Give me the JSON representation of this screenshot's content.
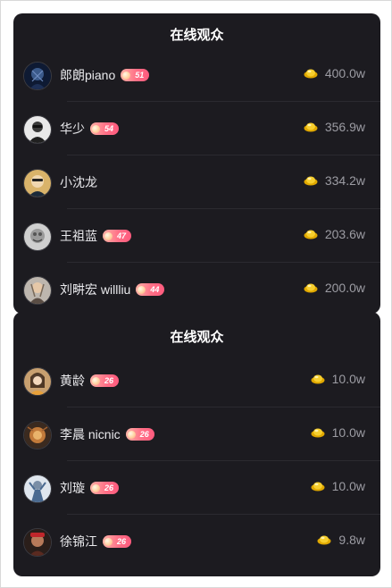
{
  "top_panel": {
    "title": "在线观众",
    "rows": [
      {
        "name": "郎朗piano",
        "level": "51",
        "value": "400.0w"
      },
      {
        "name": "华少",
        "level": "54",
        "value": "356.9w"
      },
      {
        "name": "小沈龙",
        "level": "",
        "value": "334.2w"
      },
      {
        "name": "王祖蓝",
        "level": "47",
        "value": "203.6w"
      },
      {
        "name": "刘畊宏 willliu",
        "level": "44",
        "value": "200.0w"
      }
    ]
  },
  "bottom_panel": {
    "title": "在线观众",
    "rows": [
      {
        "name": "黄龄",
        "level": "26",
        "value": "10.0w"
      },
      {
        "name": "李晨 nicnic",
        "level": "26",
        "value": "10.0w"
      },
      {
        "name": "刘璇",
        "level": "26",
        "value": "10.0w"
      },
      {
        "name": "徐锦江",
        "level": "26",
        "value": "9.8w"
      }
    ]
  },
  "icons": {
    "coin": "gold-ingot-icon",
    "level_badge": "fan-level-gem-icon"
  },
  "colors": {
    "panel_bg": "#1c1b20",
    "text_primary": "#e9e9ec",
    "text_secondary": "#9c9ca3",
    "badge_start": "#ffb3a7",
    "badge_end": "#ff5a7e",
    "coin_gold": "#f3c623"
  }
}
